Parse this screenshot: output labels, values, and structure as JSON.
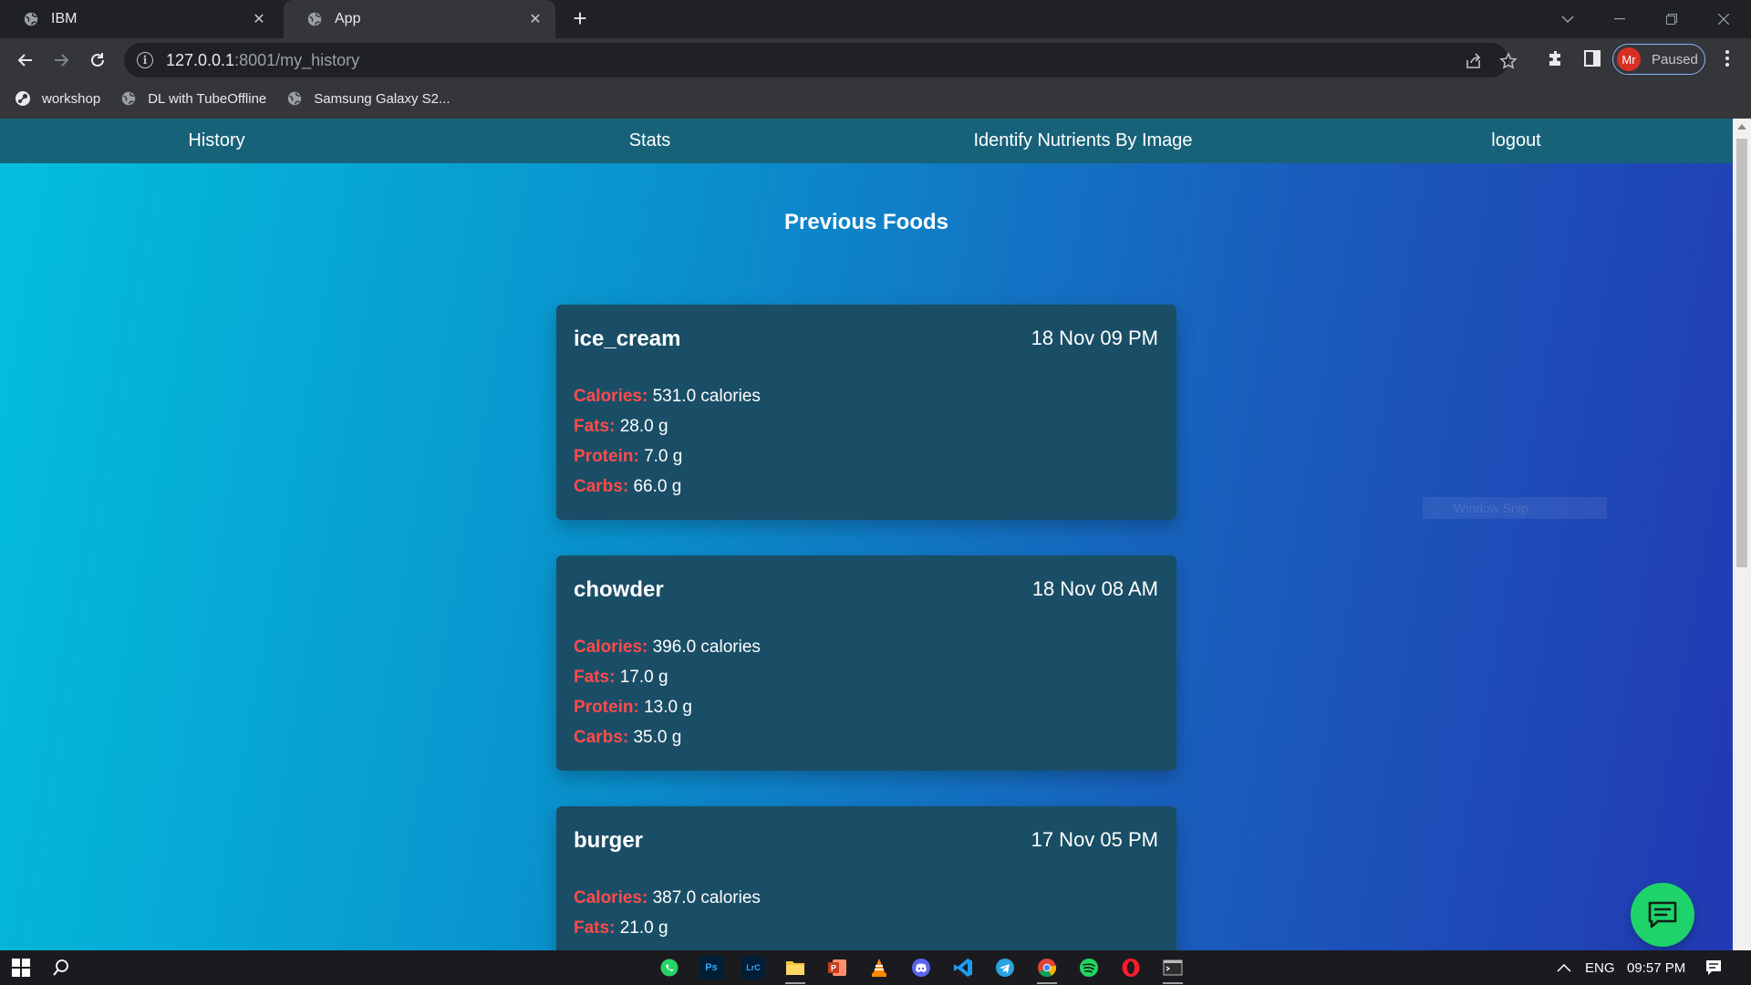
{
  "browser": {
    "tabs": [
      {
        "title": "IBM",
        "favicon": "globe-icon"
      },
      {
        "title": "App",
        "favicon": "globe-icon",
        "active": true
      }
    ],
    "url_host": "127.0.0.1",
    "url_rest": ":8001/my_history",
    "profile_initials": "Mr",
    "profile_status": "Paused",
    "bookmarks": [
      {
        "label": "workshop",
        "icon": "steam-icon"
      },
      {
        "label": "DL with TubeOffline",
        "icon": "globe-icon"
      },
      {
        "label": "Samsung Galaxy S2...",
        "icon": "globe-icon"
      }
    ]
  },
  "navbar": {
    "links": [
      "History",
      "Stats",
      "Identify Nutrients By Image",
      "logout"
    ]
  },
  "page": {
    "title": "Previous Foods",
    "labels": {
      "calories": "Calories:",
      "fats": "Fats:",
      "protein": "Protein:",
      "carbs": "Carbs:"
    },
    "foods": [
      {
        "name": "ice_cream",
        "date": "18 Nov 09 PM",
        "calories": "531.0 calories",
        "fats": "28.0 g",
        "protein": "7.0 g",
        "carbs": "66.0 g"
      },
      {
        "name": "chowder",
        "date": "18 Nov 08 AM",
        "calories": "396.0 calories",
        "fats": "17.0 g",
        "protein": "13.0 g",
        "carbs": "35.0 g"
      },
      {
        "name": "burger",
        "date": "17 Nov 05 PM",
        "calories": "387.0 calories",
        "fats": "21.0 g",
        "protein": "",
        "carbs": ""
      }
    ],
    "overlay_text": "Window Snip"
  },
  "colors": {
    "navbar_bg": "#176279",
    "card_bg": "#194e66",
    "label_red": "#ff4b4b",
    "chat_button": "#1fd36b"
  },
  "taskbar": {
    "apps": [
      "whatsapp-icon",
      "photoshop-icon",
      "lightroom-icon",
      "file-explorer-icon",
      "powerpoint-icon",
      "vlc-icon",
      "discord-icon",
      "vscode-icon",
      "telegram-icon",
      "chrome-icon",
      "spotify-icon",
      "opera-icon",
      "terminal-icon"
    ],
    "app_short": {
      "photoshop": "Ps",
      "lightroom": "LrC"
    },
    "language": "ENG",
    "time": "09:57 PM"
  }
}
